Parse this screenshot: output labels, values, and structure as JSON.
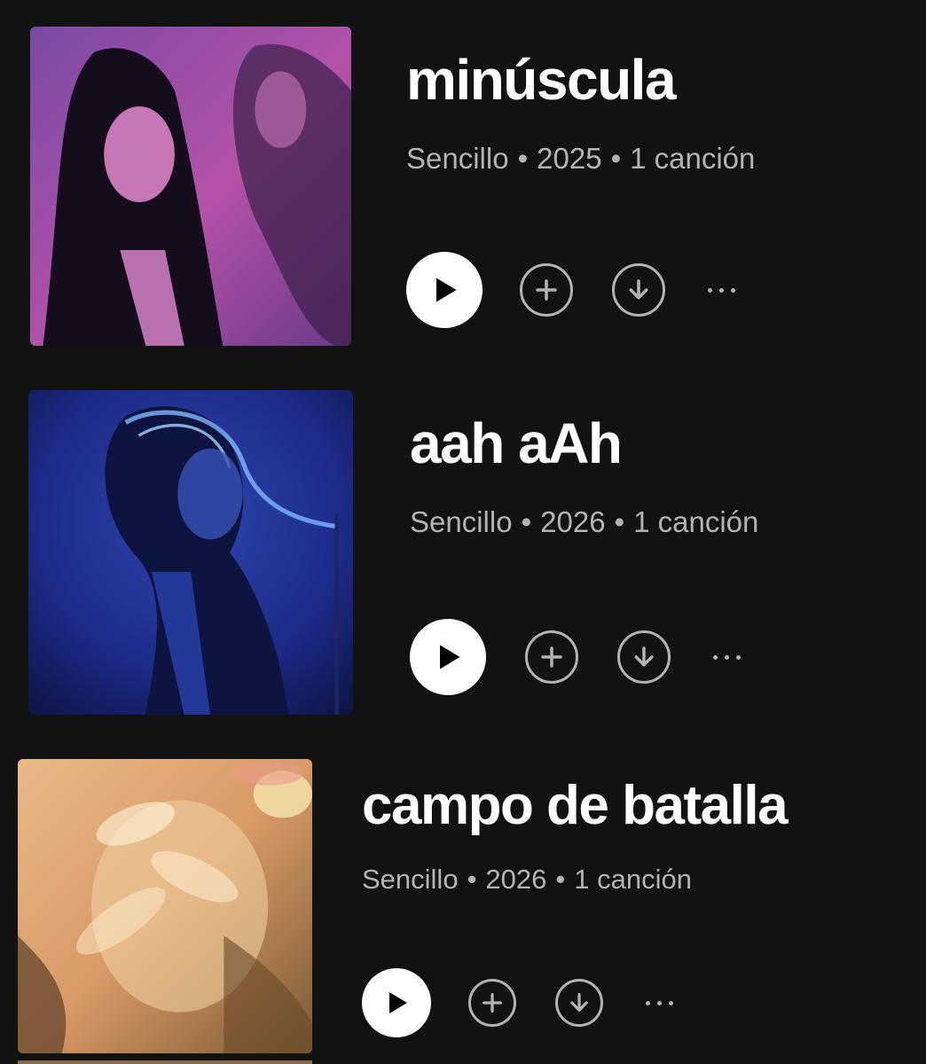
{
  "releases": [
    {
      "title": "minúscula",
      "type": "Sencillo",
      "year": "2025",
      "tracks": "1 canción",
      "cover_colors": [
        "#6b3f8f",
        "#c25fb0",
        "#1a1220"
      ]
    },
    {
      "title": "aah aAh",
      "type": "Sencillo",
      "year": "2026",
      "tracks": "1 canción",
      "cover_colors": [
        "#1b2a8a",
        "#3b63c9",
        "#0d1230"
      ]
    },
    {
      "title": "campo de batalla",
      "type": "Sencillo",
      "year": "2026",
      "tracks": "1 canción",
      "cover_colors": [
        "#d9a06a",
        "#f2d8a0",
        "#8a5a30"
      ]
    }
  ],
  "icons": {
    "play": "play-icon",
    "add": "plus-circle-icon",
    "download": "download-icon",
    "more": "more-horizontal-icon"
  },
  "colors": {
    "background": "#121212",
    "text_primary": "#ffffff",
    "text_secondary": "#b3b3b3"
  }
}
